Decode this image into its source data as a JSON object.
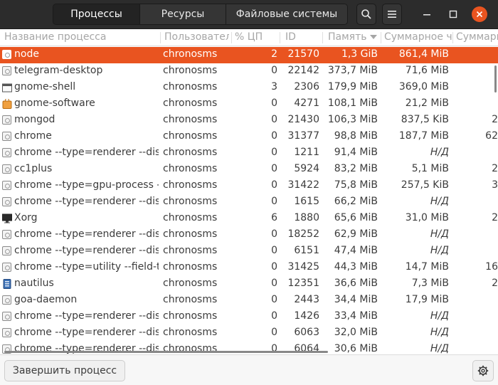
{
  "header": {
    "tabs": [
      {
        "label": "Процессы",
        "active": true
      },
      {
        "label": "Ресурсы",
        "active": false
      },
      {
        "label": "Файловые системы",
        "active": false
      }
    ]
  },
  "columns": {
    "name": "Название процесса",
    "user": "Пользовател",
    "cpu": "% ЦП",
    "pid": "ID",
    "memory": "Память",
    "total": "Суммарное ч",
    "extra": "Суммарн"
  },
  "processes": [
    {
      "icon": "generic-app-icon",
      "name": "node",
      "user": "chronosms",
      "cpu": "2",
      "pid": "21570",
      "memory": "1,3 GiB",
      "total": "861,4 MiB",
      "extra": ""
    },
    {
      "icon": "generic-app-icon",
      "name": "telegram-desktop",
      "user": "chronosms",
      "cpu": "0",
      "pid": "22142",
      "memory": "373,7 MiB",
      "total": "71,6 MiB",
      "extra": ""
    },
    {
      "icon": "window-icon",
      "name": "gnome-shell",
      "user": "chronosms",
      "cpu": "3",
      "pid": "2306",
      "memory": "179,9 MiB",
      "total": "369,0 MiB",
      "extra": ""
    },
    {
      "icon": "software-bag-icon",
      "name": "gnome-software",
      "user": "chronosms",
      "cpu": "0",
      "pid": "4271",
      "memory": "108,1 MiB",
      "total": "21,2 MiB",
      "extra": ""
    },
    {
      "icon": "generic-app-icon",
      "name": "mongod",
      "user": "chronosms",
      "cpu": "0",
      "pid": "21430",
      "memory": "106,3 MiB",
      "total": "837,5 KiB",
      "extra": "2"
    },
    {
      "icon": "generic-app-icon",
      "name": "chrome",
      "user": "chronosms",
      "cpu": "0",
      "pid": "31377",
      "memory": "98,8 MiB",
      "total": "187,7 MiB",
      "extra": "62"
    },
    {
      "icon": "generic-app-icon",
      "name": "chrome --type=renderer --disab",
      "user": "chronosms",
      "cpu": "0",
      "pid": "1211",
      "memory": "91,4 MiB",
      "total": "Н/Д",
      "extra": ""
    },
    {
      "icon": "generic-app-icon",
      "name": "cc1plus",
      "user": "chronosms",
      "cpu": "0",
      "pid": "5924",
      "memory": "83,2 MiB",
      "total": "5,1 MiB",
      "extra": "2"
    },
    {
      "icon": "generic-app-icon",
      "name": "chrome --type=gpu-process --fi",
      "user": "chronosms",
      "cpu": "0",
      "pid": "31422",
      "memory": "75,8 MiB",
      "total": "257,5 KiB",
      "extra": "3"
    },
    {
      "icon": "generic-app-icon",
      "name": "chrome --type=renderer --disab",
      "user": "chronosms",
      "cpu": "0",
      "pid": "1615",
      "memory": "66,2 MiB",
      "total": "Н/Д",
      "extra": ""
    },
    {
      "icon": "monitor-icon",
      "name": "Xorg",
      "user": "chronosms",
      "cpu": "6",
      "pid": "1880",
      "memory": "65,6 MiB",
      "total": "31,0 MiB",
      "extra": "2"
    },
    {
      "icon": "generic-app-icon",
      "name": "chrome --type=renderer --disab",
      "user": "chronosms",
      "cpu": "0",
      "pid": "18252",
      "memory": "62,9 MiB",
      "total": "Н/Д",
      "extra": ""
    },
    {
      "icon": "generic-app-icon",
      "name": "chrome --type=renderer --disab",
      "user": "chronosms",
      "cpu": "0",
      "pid": "6151",
      "memory": "47,4 MiB",
      "total": "Н/Д",
      "extra": ""
    },
    {
      "icon": "generic-app-icon",
      "name": "chrome --type=utility --field-tria",
      "user": "chronosms",
      "cpu": "0",
      "pid": "31425",
      "memory": "44,3 MiB",
      "total": "14,7 MiB",
      "extra": "16"
    },
    {
      "icon": "file-manager-icon",
      "name": "nautilus",
      "user": "chronosms",
      "cpu": "0",
      "pid": "12351",
      "memory": "36,6 MiB",
      "total": "7,3 MiB",
      "extra": "2"
    },
    {
      "icon": "generic-app-icon",
      "name": "goa-daemon",
      "user": "chronosms",
      "cpu": "0",
      "pid": "2443",
      "memory": "34,4 MiB",
      "total": "17,9 MiB",
      "extra": ""
    },
    {
      "icon": "generic-app-icon",
      "name": "chrome --type=renderer --disab",
      "user": "chronosms",
      "cpu": "0",
      "pid": "1426",
      "memory": "33,4 MiB",
      "total": "Н/Д",
      "extra": ""
    },
    {
      "icon": "generic-app-icon",
      "name": "chrome --type=renderer --disab",
      "user": "chronosms",
      "cpu": "0",
      "pid": "6063",
      "memory": "32,0 MiB",
      "total": "Н/Д",
      "extra": ""
    },
    {
      "icon": "generic-app-icon",
      "name": "chrome --type=renderer --disab",
      "user": "chronosms",
      "cpu": "0",
      "pid": "6064",
      "memory": "30,6 MiB",
      "total": "Н/Д",
      "extra": ""
    }
  ],
  "footer": {
    "end_process_label": "Завершить процесс"
  },
  "colors": {
    "accent": "#e95420",
    "headerbar": "#2c2c2c"
  }
}
